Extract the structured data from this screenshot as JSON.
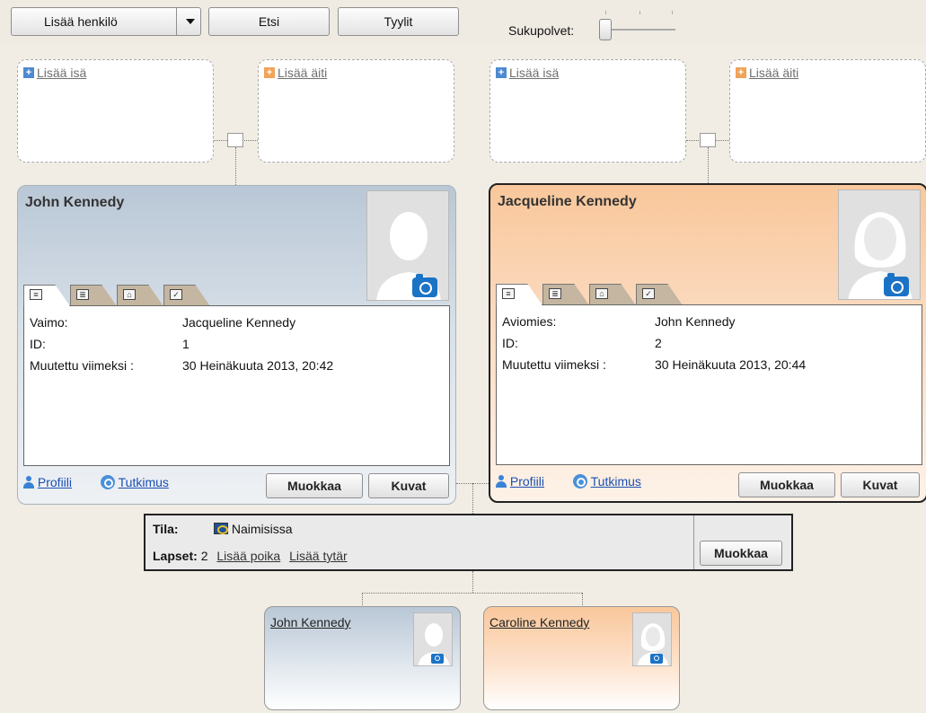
{
  "toolbar": {
    "add_person_label": "Lisää henkilö",
    "search_label": "Etsi",
    "styles_label": "Tyylit",
    "generations_label": "Sukupolvet:"
  },
  "placeholders": {
    "add_father": "Lisää isä",
    "add_mother": "Lisää äiti"
  },
  "person_left": {
    "name": "John Kennedy",
    "fields": [
      {
        "label": "Vaimo:",
        "value": "Jacqueline Kennedy"
      },
      {
        "label": "ID:",
        "value": "1"
      },
      {
        "label": "Muutettu viimeksi :",
        "value": "30 Heinäkuuta 2013, 20:42"
      }
    ],
    "profile_link": "Profiili",
    "research_link": "Tutkimus",
    "edit_button": "Muokkaa",
    "photos_button": "Kuvat"
  },
  "person_right": {
    "name": "Jacqueline Kennedy",
    "fields": [
      {
        "label": "Aviomies:",
        "value": "John Kennedy"
      },
      {
        "label": "ID:",
        "value": "2"
      },
      {
        "label": "Muutettu viimeksi :",
        "value": "30 Heinäkuuta 2013, 20:44"
      }
    ],
    "profile_link": "Profiili",
    "research_link": "Tutkimus",
    "edit_button": "Muokkaa",
    "photos_button": "Kuvat"
  },
  "family": {
    "status_label": "Tila:",
    "status_value": "Naimisissa",
    "children_label": "Lapset:",
    "children_count": "2",
    "add_son": "Lisää poika",
    "add_daughter": "Lisää tytär",
    "edit_button": "Muokkaa"
  },
  "children": [
    {
      "name": "John Kennedy"
    },
    {
      "name": "Caroline Kennedy"
    }
  ],
  "colors": {
    "male_card": "#b9c7d6",
    "female_card": "#f9c79b",
    "link": "#1b4fb3",
    "camera": "#1b73c6"
  }
}
